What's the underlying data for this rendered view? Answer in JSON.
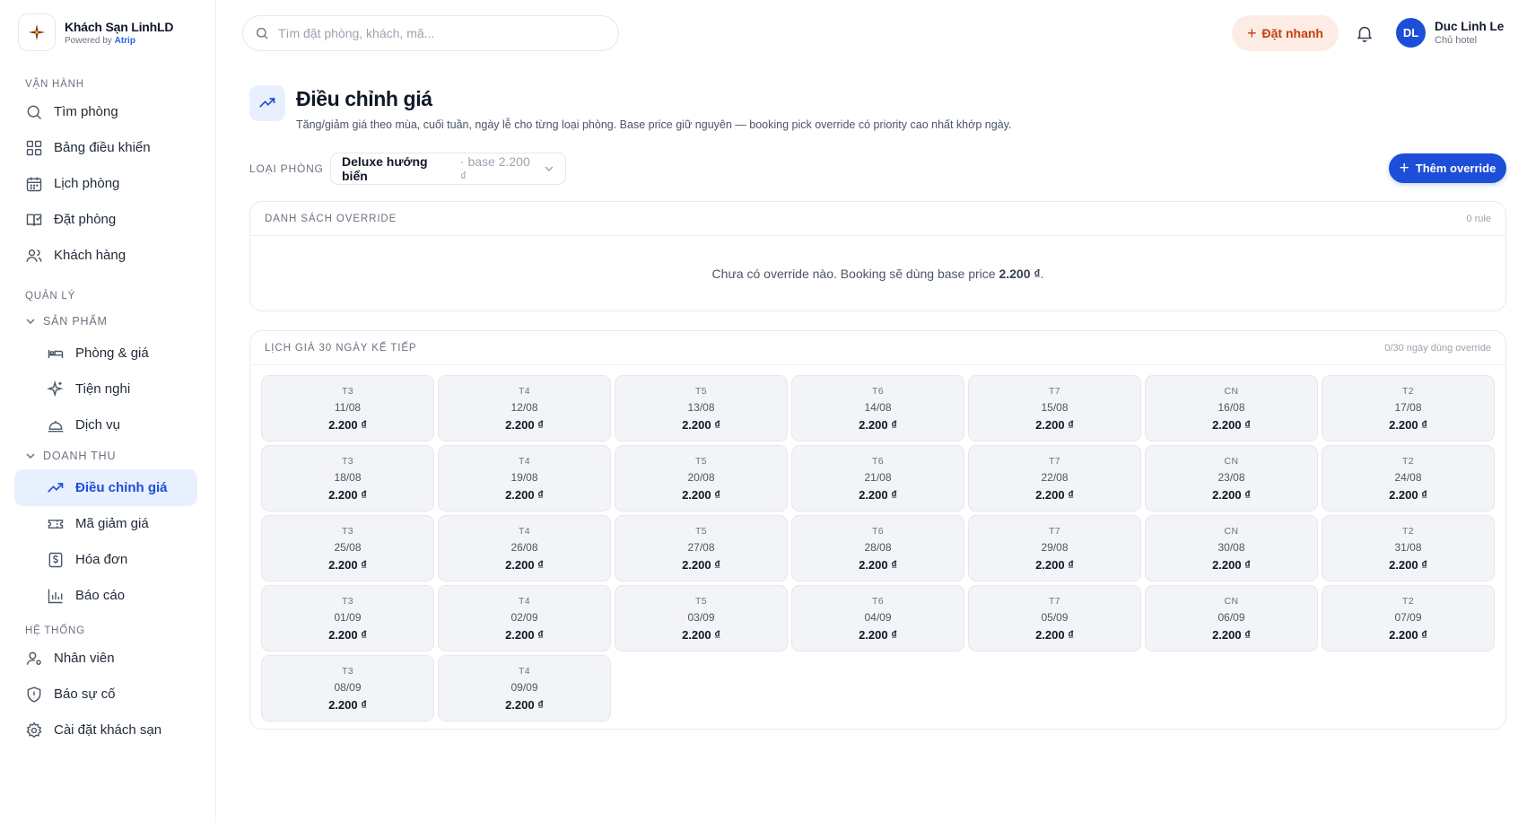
{
  "brand": {
    "name": "Khách Sạn LinhLD",
    "powered_prefix": "Powered by",
    "powered_brand": "Atrip"
  },
  "search": {
    "placeholder": "Tìm đặt phòng, khách, mã..."
  },
  "topbar": {
    "quick_label": "Đặt nhanh"
  },
  "user": {
    "initials": "DL",
    "name": "Duc Linh Le",
    "role": "Chủ hotel"
  },
  "sidebar": {
    "sections": {
      "ops": "VẬN HÀNH",
      "manage": "QUẢN LÝ",
      "system": "HỆ THỐNG"
    },
    "groups": {
      "products": "SẢN PHẨM",
      "revenue": "DOANH THU"
    },
    "items": {
      "find_room": "Tìm phòng",
      "dashboard": "Bảng điều khiển",
      "calendar": "Lịch phòng",
      "booking": "Đặt phòng",
      "customers": "Khách hàng",
      "rooms_prices": "Phòng & giá",
      "amenities": "Tiện nghi",
      "services": "Dịch vụ",
      "price_adjust": "Điều chỉnh giá",
      "vouchers": "Mã giảm giá",
      "invoices": "Hóa đơn",
      "reports": "Báo cáo",
      "staff": "Nhân viên",
      "incidents": "Báo sự cố",
      "settings": "Cài đặt khách sạn"
    }
  },
  "page": {
    "title": "Điều chỉnh giá",
    "description": "Tăng/giảm giá theo mùa, cuối tuần, ngày lễ cho từng loại phòng. Base price giữ nguyên — booking pick override có priority cao nhất khớp ngày."
  },
  "room_type": {
    "label": "LOẠI PHÒNG",
    "selected": "Deluxe hướng biển",
    "base_text": "· base 2.200 ₫"
  },
  "add_button": "Thêm override",
  "override_list": {
    "title": "DANH SÁCH OVERRIDE",
    "count": "0 rule",
    "empty_prefix": "Chưa có override nào. Booking sẽ dùng base price ",
    "empty_price": "2.200 ₫",
    "empty_suffix": "."
  },
  "calendar": {
    "title": "LỊCH GIÁ 30 NGÀY KẾ TIẾP",
    "meta": "0/30 ngày dùng override",
    "days": [
      {
        "dow": "T3",
        "date": "11/08",
        "price": "2.200 ₫"
      },
      {
        "dow": "T4",
        "date": "12/08",
        "price": "2.200 ₫"
      },
      {
        "dow": "T5",
        "date": "13/08",
        "price": "2.200 ₫"
      },
      {
        "dow": "T6",
        "date": "14/08",
        "price": "2.200 ₫"
      },
      {
        "dow": "T7",
        "date": "15/08",
        "price": "2.200 ₫"
      },
      {
        "dow": "CN",
        "date": "16/08",
        "price": "2.200 ₫"
      },
      {
        "dow": "T2",
        "date": "17/08",
        "price": "2.200 ₫"
      },
      {
        "dow": "T3",
        "date": "18/08",
        "price": "2.200 ₫"
      },
      {
        "dow": "T4",
        "date": "19/08",
        "price": "2.200 ₫"
      },
      {
        "dow": "T5",
        "date": "20/08",
        "price": "2.200 ₫"
      },
      {
        "dow": "T6",
        "date": "21/08",
        "price": "2.200 ₫"
      },
      {
        "dow": "T7",
        "date": "22/08",
        "price": "2.200 ₫"
      },
      {
        "dow": "CN",
        "date": "23/08",
        "price": "2.200 ₫"
      },
      {
        "dow": "T2",
        "date": "24/08",
        "price": "2.200 ₫"
      },
      {
        "dow": "T3",
        "date": "25/08",
        "price": "2.200 ₫"
      },
      {
        "dow": "T4",
        "date": "26/08",
        "price": "2.200 ₫"
      },
      {
        "dow": "T5",
        "date": "27/08",
        "price": "2.200 ₫"
      },
      {
        "dow": "T6",
        "date": "28/08",
        "price": "2.200 ₫"
      },
      {
        "dow": "T7",
        "date": "29/08",
        "price": "2.200 ₫"
      },
      {
        "dow": "CN",
        "date": "30/08",
        "price": "2.200 ₫"
      },
      {
        "dow": "T2",
        "date": "31/08",
        "price": "2.200 ₫"
      },
      {
        "dow": "T3",
        "date": "01/09",
        "price": "2.200 ₫"
      },
      {
        "dow": "T4",
        "date": "02/09",
        "price": "2.200 ₫"
      },
      {
        "dow": "T5",
        "date": "03/09",
        "price": "2.200 ₫"
      },
      {
        "dow": "T6",
        "date": "04/09",
        "price": "2.200 ₫"
      },
      {
        "dow": "T7",
        "date": "05/09",
        "price": "2.200 ₫"
      },
      {
        "dow": "CN",
        "date": "06/09",
        "price": "2.200 ₫"
      },
      {
        "dow": "T2",
        "date": "07/09",
        "price": "2.200 ₫"
      },
      {
        "dow": "T3",
        "date": "08/09",
        "price": "2.200 ₫"
      },
      {
        "dow": "T4",
        "date": "09/09",
        "price": "2.200 ₫"
      }
    ]
  },
  "colors": {
    "accent": "#1d4ed8",
    "quick_bg": "#fdece6",
    "quick_fg": "#c2410c",
    "active_bg": "#e8f0fe"
  },
  "icons": {
    "logo": "compass-star-icon",
    "search": "search-icon",
    "quick": "plus-icon",
    "bell": "bell-icon",
    "find_room": "search-icon",
    "dashboard": "grid-icon",
    "calendar": "calendar-icon",
    "booking": "book-icon",
    "customers": "users-icon",
    "rooms_prices": "bed-icon",
    "amenities": "sparkle-icon",
    "services": "bell-service-icon",
    "price_adjust": "trend-up-icon",
    "vouchers": "ticket-icon",
    "invoices": "invoice-icon",
    "reports": "bar-chart-icon",
    "staff": "user-gear-icon",
    "incidents": "shield-alert-icon",
    "settings": "gear-icon"
  }
}
